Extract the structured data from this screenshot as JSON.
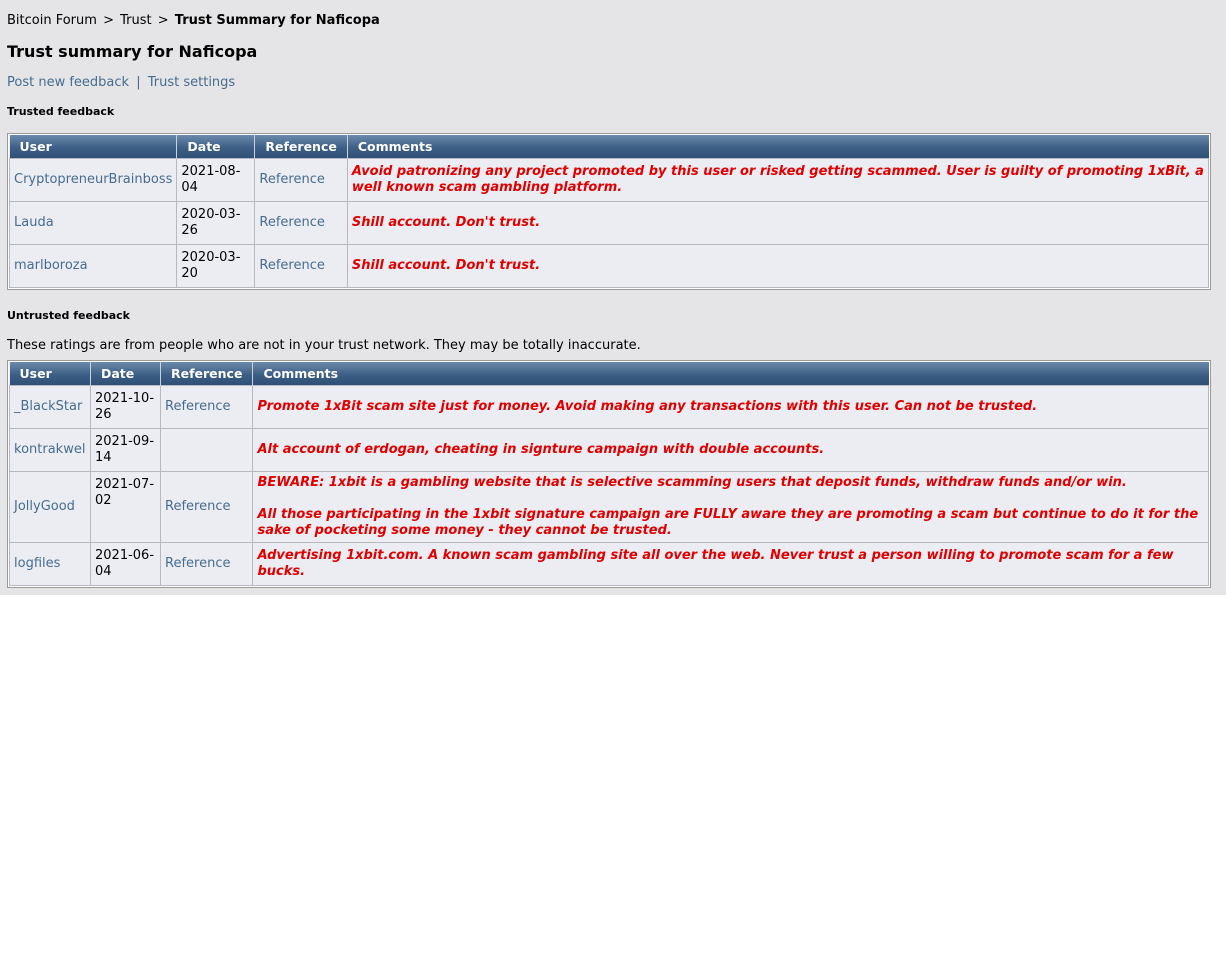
{
  "breadcrumb": {
    "items": [
      "Bitcoin Forum",
      "Trust"
    ],
    "separator": ">",
    "current": "Trust Summary for Naficopa"
  },
  "page_title": "Trust summary for Naficopa",
  "actions": {
    "post_feedback": "Post new feedback",
    "separator": "|",
    "trust_settings": "Trust settings"
  },
  "trusted": {
    "heading": "Trusted feedback",
    "columns": [
      "User",
      "Date",
      "Reference",
      "Comments"
    ],
    "rows": [
      {
        "user": "CryptopreneurBrainboss",
        "date": "2021-08-04",
        "reference": "Reference",
        "comment": [
          "Avoid patronizing any project promoted by this user or risked getting scammed. User is guilty of promoting 1xBit, a well known scam gambling platform."
        ]
      },
      {
        "user": "Lauda",
        "date": "2020-03-26",
        "reference": "Reference",
        "comment": [
          "Shill account. Don't trust."
        ]
      },
      {
        "user": "marlboroza",
        "date": "2020-03-20",
        "reference": "Reference",
        "comment": [
          "Shill account. Don't trust."
        ]
      }
    ]
  },
  "untrusted": {
    "heading": "Untrusted feedback",
    "note": "These ratings are from people who are not in your trust network. They may be totally inaccurate.",
    "columns": [
      "User",
      "Date",
      "Reference",
      "Comments"
    ],
    "rows": [
      {
        "user": "_BlackStar",
        "date": "2021-10-26",
        "reference": "Reference",
        "comment": [
          "Promote 1xBit scam site just for money. Avoid making any transactions with this user. Can not be trusted."
        ]
      },
      {
        "user": "kontrakwel",
        "date": "2021-09-14",
        "reference": "",
        "comment": [
          "Alt account of erdogan, cheating in signture campaign with double accounts."
        ]
      },
      {
        "user": "JollyGood",
        "date": "2021-07-02",
        "reference": "Reference",
        "comment": [
          "BEWARE: 1xbit is a gambling website that is selective scamming users that deposit funds, withdraw funds and/or win.",
          "All those participating in the 1xbit signature campaign are FULLY aware they are promoting a scam but continue to do it for the sake of pocketing some money - they cannot be trusted."
        ]
      },
      {
        "user": "logfiles",
        "date": "2021-06-04",
        "reference": "Reference",
        "comment": [
          "Advertising 1xbit.com. A known scam gambling site all over the web. Never trust a person willing to promote scam for a few bucks."
        ]
      }
    ]
  }
}
